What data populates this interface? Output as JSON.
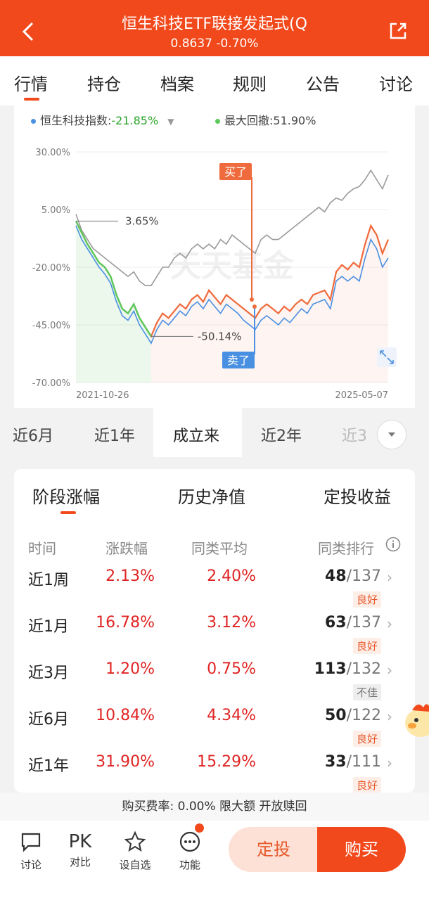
{
  "header": {
    "title": "恒生科技ETF联接发起式(Q",
    "nav": "0.8637",
    "change": "-0.70%"
  },
  "tabs": [
    "行情",
    "持仓",
    "档案",
    "规则",
    "公告",
    "讨论"
  ],
  "legend": {
    "index_label": "恒生科技指数:",
    "index_value": "-21.85%",
    "drawdown_label": "最大回撤:",
    "drawdown_value": "51.90%"
  },
  "chart_data": {
    "type": "line",
    "y_ticks": [
      "30.00%",
      "5.00%",
      "-20.00%",
      "-45.00%",
      "-70.00%"
    ],
    "ylim": [
      -70,
      30
    ],
    "x_start_label": "2021-10-26",
    "x_end_label": "2025-05-07",
    "max_annotation": "3.65%",
    "min_annotation": "-50.14%",
    "buy_label": "买了",
    "sell_label": "卖了",
    "watermark": "天天基金",
    "colors": {
      "fund": "#ef6a3c",
      "index": "#4a90e2",
      "peer": "#9a9a9a",
      "drawdown": "#5bc85b"
    },
    "series": [
      {
        "name": "fund",
        "values": [
          0,
          -5,
          -10,
          -14,
          -18,
          -20,
          -24,
          -32,
          -38,
          -40,
          -36,
          -42,
          -46,
          -50,
          -44,
          -40,
          -42,
          -39,
          -36,
          -38,
          -34,
          -32,
          -35,
          -30,
          -33,
          -36,
          -32,
          -34,
          -36,
          -38,
          -40,
          -42,
          -38,
          -36,
          -38,
          -40,
          -37,
          -39,
          -36,
          -34,
          -36,
          -32,
          -31,
          -30,
          -34,
          -22,
          -19,
          -21,
          -18,
          -20,
          -10,
          -2,
          -6,
          -14,
          -8
        ]
      },
      {
        "name": "index",
        "values": [
          -2,
          -8,
          -12,
          -16,
          -20,
          -23,
          -27,
          -35,
          -41,
          -43,
          -39,
          -45,
          -49,
          -53,
          -47,
          -43,
          -45,
          -42,
          -39,
          -41,
          -37,
          -35,
          -38,
          -34,
          -37,
          -40,
          -36,
          -38,
          -40,
          -43,
          -45,
          -47,
          -43,
          -41,
          -43,
          -45,
          -42,
          -44,
          -41,
          -38,
          -40,
          -36,
          -35,
          -34,
          -38,
          -26,
          -24,
          -26,
          -24,
          -26,
          -16,
          -8,
          -12,
          -20,
          -16
        ]
      },
      {
        "name": "peer",
        "values": [
          3,
          -4,
          -8,
          -12,
          -14,
          -16,
          -18,
          -20,
          -22,
          -24,
          -22,
          -26,
          -28,
          -28,
          -24,
          -20,
          -20,
          -16,
          -14,
          -16,
          -12,
          -10,
          -12,
          -10,
          -12,
          -8,
          -10,
          -6,
          -8,
          -10,
          -12,
          -14,
          -8,
          -6,
          -8,
          -8,
          -6,
          -4,
          -2,
          0,
          2,
          4,
          6,
          4,
          8,
          10,
          9,
          12,
          14,
          15,
          18,
          22,
          18,
          14,
          20
        ]
      }
    ]
  },
  "periods": [
    "近6月",
    "近1年",
    "成立来",
    "近2年",
    "近3"
  ],
  "subtabs": [
    "阶段涨幅",
    "历史净值",
    "定投收益"
  ],
  "table": {
    "headers": [
      "时间",
      "涨跌幅",
      "同类平均",
      "同类排行"
    ],
    "rows": [
      {
        "period": "近1周",
        "change": "2.13%",
        "avg": "2.40%",
        "rank": "48",
        "total": "/137",
        "level": "良好"
      },
      {
        "period": "近1月",
        "change": "16.78%",
        "avg": "3.12%",
        "rank": "63",
        "total": "/137",
        "level": "良好"
      },
      {
        "period": "近3月",
        "change": "1.20%",
        "avg": "0.75%",
        "rank": "113",
        "total": "/132",
        "level": "不佳"
      },
      {
        "period": "近6月",
        "change": "10.84%",
        "avg": "4.34%",
        "rank": "50",
        "total": "/122",
        "level": "良好"
      },
      {
        "period": "近1年",
        "change": "31.90%",
        "avg": "15.29%",
        "rank": "33",
        "total": "/111",
        "level": "良好"
      }
    ]
  },
  "fee": {
    "text": "购买费率: 0.00% 限大额 开放赎回"
  },
  "bottom": {
    "discuss": "讨论",
    "pk_glyph": "PK",
    "pk": "对比",
    "watch": "设自选",
    "func": "功能",
    "auto_invest": "定投",
    "buy": "购买"
  }
}
